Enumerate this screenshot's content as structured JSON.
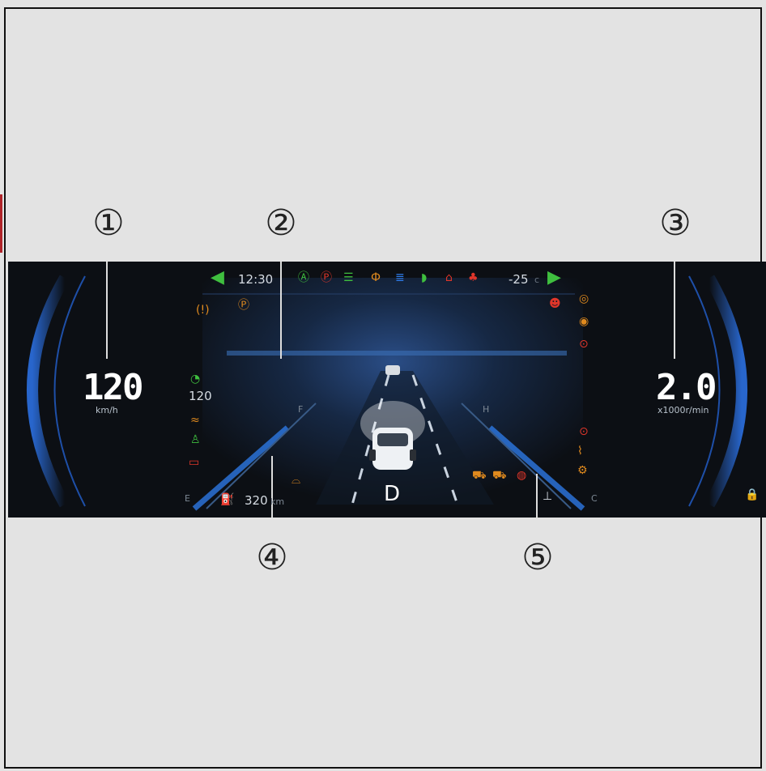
{
  "callouts": [
    "①",
    "②",
    "③",
    "④",
    "⑤"
  ],
  "speed": {
    "value": "120",
    "unit": "km/h"
  },
  "tach": {
    "value": "2.0",
    "unit": "x1000r/min"
  },
  "top_bar": {
    "time": "12:30",
    "temperature": "-25",
    "temp_unit": "c"
  },
  "cruise_speed": "120",
  "gear": "D",
  "range": {
    "value": "320",
    "unit": "km"
  },
  "fuel_gauge": {
    "full": "F",
    "empty": "E"
  },
  "temp_gauge": {
    "hot": "H",
    "cold": "C"
  },
  "colors": {
    "green": "#3fbf3f",
    "red": "#e0362a",
    "amber": "#e08a1e",
    "blue": "#2f7ff0",
    "bg": "#0c0f14"
  },
  "icons": {
    "top": [
      "auto-hold-icon",
      "parking-brake-icon",
      "position-lamp-icon",
      "rear-fog-icon",
      "high-beam-icon",
      "front-fog-icon",
      "door-open-icon",
      "seatbelt-icon"
    ],
    "left": [
      "tire-pressure-icon",
      "epb-icon",
      "cruise-icon",
      "esp-off-icon",
      "seat-icon",
      "battery-icon"
    ],
    "right": [
      "airbag-icon",
      "steering-icon",
      "brake-wear-icon",
      "abs-icon",
      "brake-fault-icon",
      "oil-pressure-icon",
      "engine-check-icon",
      "coolant-icon"
    ],
    "bottom": [
      "lane-assist-icon",
      "front-car-icon",
      "rear-car-icon",
      "tpms-icon",
      "lock-icon",
      "fuel-pump-icon"
    ]
  }
}
